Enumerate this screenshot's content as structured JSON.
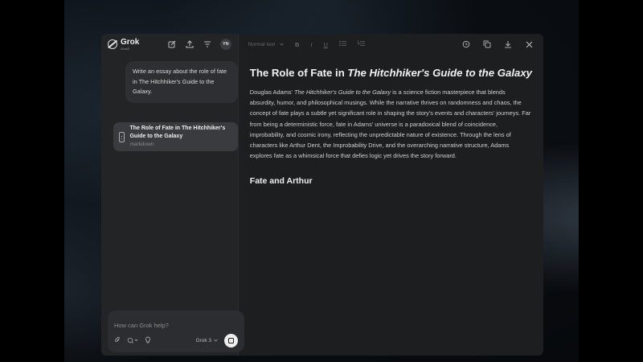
{
  "sidebar": {
    "logo_name": "Grok",
    "logo_sub": "Grok3",
    "avatar": "YN",
    "icons": [
      "edit-icon",
      "upload-icon",
      "filter-icon"
    ]
  },
  "chat": {
    "user_message": "Write an essay about the role of fate in The Hitchhiker's Guide to the Galaxy.",
    "artifact_title": "The Role of Fate in The Hitchhiker's Guide to the Galaxy",
    "artifact_type": "markdown"
  },
  "composer": {
    "placeholder": "How can Grok help?",
    "model": "Grok 3"
  },
  "toolbar": {
    "style": "Normal text",
    "bold": "B",
    "italic": "I",
    "underline": "U"
  },
  "document": {
    "title_prefix": "The Role of Fate in ",
    "title_italic": "The Hitchhiker's Guide to the Galaxy",
    "para_start": "Douglas Adams' ",
    "para_italic": "The Hitchhiker's Guide to the Galaxy",
    "para_rest": " is a science fiction masterpiece that blends absurdity, humor, and philosophical musings. While the narrative thrives on randomness and chaos, the concept of fate plays a subtle yet significant role in shaping the story's events and characters' journeys. Far from being a deterministic force, fate in Adams' universe is a paradoxical blend of coincidence, improbability, and cosmic irony, reflecting the unpredictable nature of existence. Through the lens of characters like Arthur Dent, the Improbability Drive, and the overarching narrative structure, Adams explores fate as a whimsical force that defies logic yet drives the story forward.",
    "heading_2": "Fate and Arthur"
  }
}
